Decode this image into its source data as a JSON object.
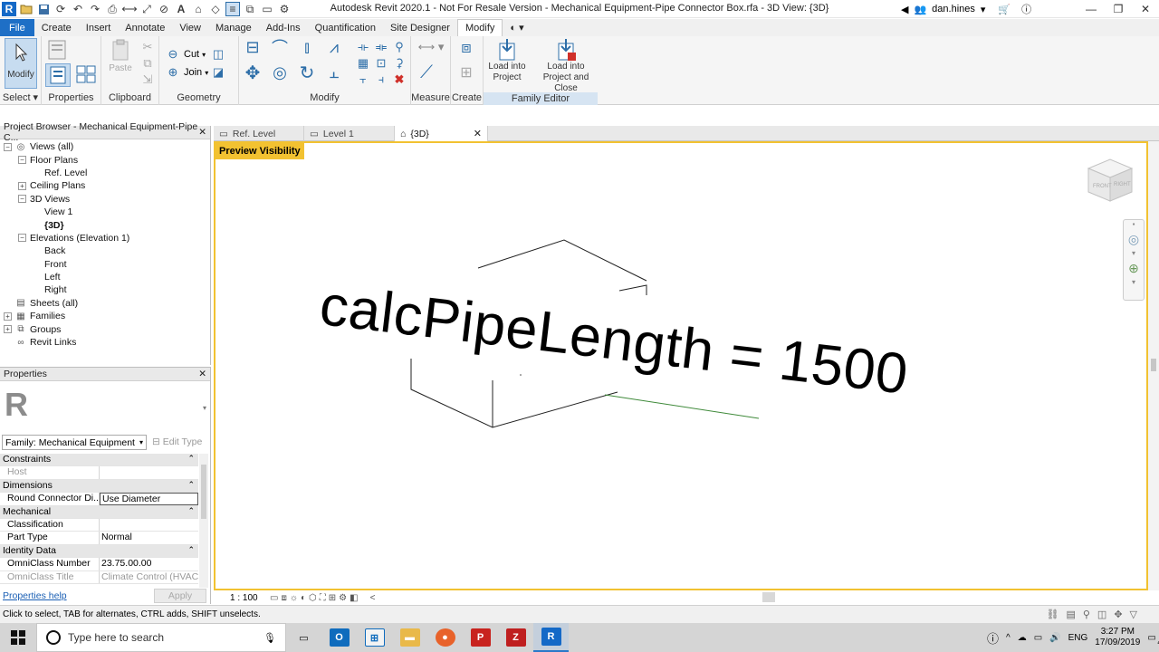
{
  "app": {
    "title": "Autodesk Revit 2020.1 - Not For Resale Version - Mechanical Equipment-Pipe Connector Box.rfa - 3D View: {3D}",
    "user": "dan.hines"
  },
  "menu_tabs": [
    "File",
    "Create",
    "Insert",
    "Annotate",
    "View",
    "Manage",
    "Add-Ins",
    "Quantification",
    "Site Designer",
    "Modify"
  ],
  "ribbon": {
    "select_label": "Select",
    "modify_btn": "Modify",
    "properties_label": "Properties",
    "paste_label": "Paste",
    "clipboard_label": "Clipboard",
    "cut_label": "Cut",
    "join_label": "Join",
    "geometry_label": "Geometry",
    "modify_panel_label": "Modify",
    "measure_label": "Measure",
    "create_label": "Create",
    "load_into_project": "Load into Project",
    "load_into_project_close": "Load into Project and Close",
    "family_editor_label": "Family Editor"
  },
  "project_browser": {
    "title": "Project Browser - Mechanical Equipment-Pipe C...",
    "nodes": [
      {
        "label": "Views (all)",
        "level": 0,
        "expander": "-",
        "icon": "views-icon"
      },
      {
        "label": "Floor Plans",
        "level": 1,
        "expander": "-"
      },
      {
        "label": "Ref. Level",
        "level": 2,
        "expander": ""
      },
      {
        "label": "Ceiling Plans",
        "level": 1,
        "expander": "+"
      },
      {
        "label": "3D Views",
        "level": 1,
        "expander": "-"
      },
      {
        "label": "View 1",
        "level": 2,
        "expander": ""
      },
      {
        "label": "{3D}",
        "level": 2,
        "expander": "",
        "bold": true
      },
      {
        "label": "Elevations (Elevation 1)",
        "level": 1,
        "expander": "-"
      },
      {
        "label": "Back",
        "level": 2,
        "expander": ""
      },
      {
        "label": "Front",
        "level": 2,
        "expander": ""
      },
      {
        "label": "Left",
        "level": 2,
        "expander": ""
      },
      {
        "label": "Right",
        "level": 2,
        "expander": ""
      },
      {
        "label": "Sheets (all)",
        "level": 0,
        "expander": "",
        "icon": "sheets-icon"
      },
      {
        "label": "Families",
        "level": 0,
        "expander": "+",
        "icon": "families-icon"
      },
      {
        "label": "Groups",
        "level": 0,
        "expander": "+",
        "icon": "groups-icon"
      },
      {
        "label": "Revit Links",
        "level": 0,
        "expander": "",
        "icon": "revit-links-icon"
      }
    ]
  },
  "properties": {
    "title": "Properties",
    "family_selector": "Family: Mechanical Equipment",
    "edit_type": "Edit Type",
    "rows": [
      {
        "type": "group",
        "label": "Constraints"
      },
      {
        "type": "row",
        "key": "Host",
        "value": "",
        "dim": true
      },
      {
        "type": "group",
        "label": "Dimensions"
      },
      {
        "type": "row",
        "key": "Round Connector Di...",
        "value": "Use Diameter",
        "boxed": true
      },
      {
        "type": "group",
        "label": "Mechanical"
      },
      {
        "type": "row",
        "key": "Classification",
        "value": ""
      },
      {
        "type": "row",
        "key": "Part Type",
        "value": "Normal"
      },
      {
        "type": "group",
        "label": "Identity Data"
      },
      {
        "type": "row",
        "key": "OmniClass Number",
        "value": "23.75.00.00"
      },
      {
        "type": "row",
        "key": "OmniClass Title",
        "value": "Climate Control (HVAC)",
        "dim": true
      }
    ],
    "help_link": "Properties help",
    "apply": "Apply"
  },
  "view_tabs": [
    {
      "label": "Ref. Level",
      "active": false
    },
    {
      "label": "Level 1",
      "active": false
    },
    {
      "label": "{3D}",
      "active": true
    }
  ],
  "viewport": {
    "preview_label": "Preview Visibility",
    "overlay_text": "calcPipeLength = 1500",
    "viewcube_front": "FRONT",
    "viewcube_right": "RIGHT"
  },
  "view_control": {
    "scale": "1 : 100"
  },
  "status_bar": {
    "message": "Click to select, TAB for alternates, CTRL adds, SHIFT unselects."
  },
  "taskbar": {
    "search_placeholder": "Type here to search",
    "lang": "ENG",
    "time": "3:27 PM",
    "date": "17/09/2019",
    "notifications": "4"
  }
}
